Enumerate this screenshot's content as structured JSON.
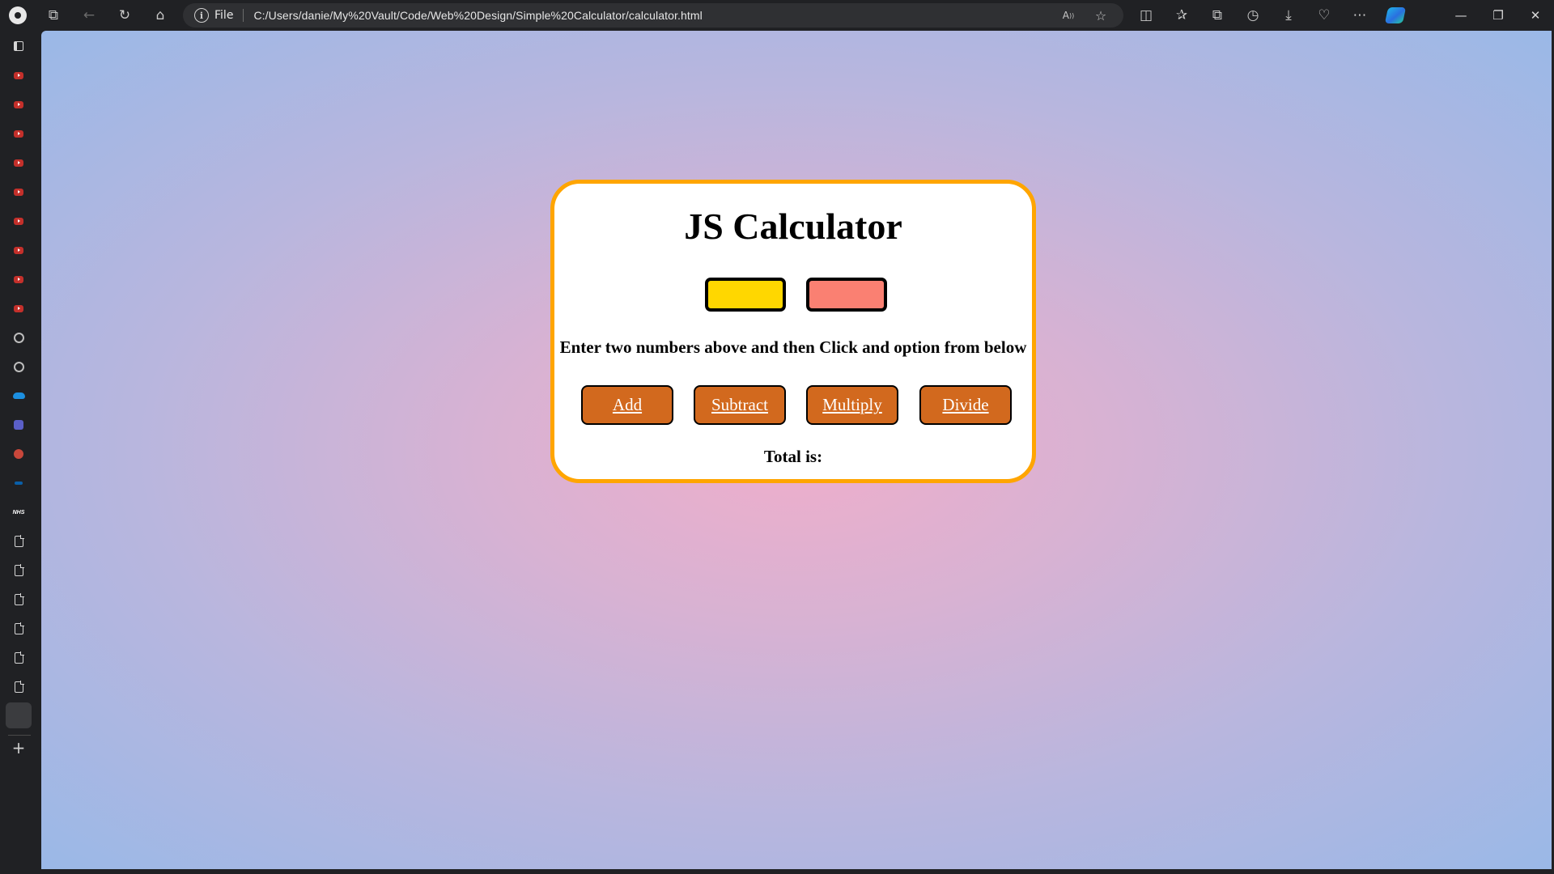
{
  "browser": {
    "address_scheme": "File",
    "address_url": "C:/Users/danie/My%20Vault/Code/Web%20Design/Simple%20Calculator/calculator.html"
  },
  "sidebar": {
    "items": [
      {
        "icon": "youtube-icon"
      },
      {
        "icon": "youtube-icon"
      },
      {
        "icon": "youtube-icon"
      },
      {
        "icon": "youtube-icon"
      },
      {
        "icon": "youtube-icon"
      },
      {
        "icon": "youtube-icon"
      },
      {
        "icon": "youtube-icon"
      },
      {
        "icon": "youtube-icon"
      },
      {
        "icon": "youtube-icon"
      },
      {
        "icon": "github-icon"
      },
      {
        "icon": "github-icon"
      },
      {
        "icon": "onedrive-icon"
      },
      {
        "icon": "teams-icon"
      },
      {
        "icon": "powerpoint-icon"
      },
      {
        "icon": "link-icon"
      },
      {
        "icon": "nhs-icon",
        "label": "NHS"
      },
      {
        "icon": "document-icon"
      },
      {
        "icon": "document-icon"
      },
      {
        "icon": "document-icon"
      },
      {
        "icon": "document-icon"
      },
      {
        "icon": "document-icon"
      },
      {
        "icon": "document-icon"
      }
    ]
  },
  "page": {
    "title": "JS Calculator",
    "input_a_value": "",
    "input_b_value": "",
    "instructions": "Enter two numbers above and then Click and option from below",
    "buttons": {
      "add": "Add",
      "subtract": "Subtract",
      "multiply": "Multiply",
      "divide": "Divide"
    },
    "total_label": "Total is:"
  },
  "colors": {
    "card_border": "#ffa500",
    "input_a": "#ffd700",
    "input_b": "#fa8072",
    "button": "#d2691e",
    "background_center": "#efaecb",
    "background_edge": "#9ab8e7"
  }
}
